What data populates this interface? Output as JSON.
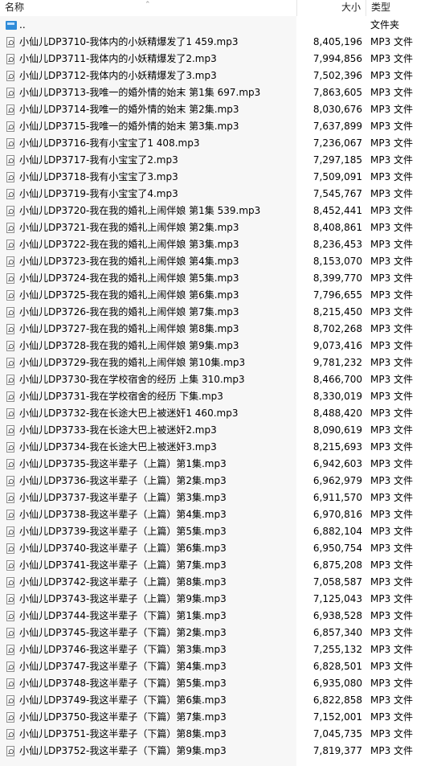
{
  "columns": {
    "name": "名称",
    "size": "大小",
    "type": "类型"
  },
  "parent_row": {
    "name": "..",
    "type": "文件夹",
    "icon": "folder-up-icon"
  },
  "file_icon": "audio-file-icon",
  "files": [
    {
      "name": "小仙儿DP3710-我体内的小妖精爆发了1 459.mp3",
      "size": "8,405,196",
      "type": "MP3 文件"
    },
    {
      "name": "小仙儿DP3711-我体内的小妖精爆发了2.mp3",
      "size": "7,994,856",
      "type": "MP3 文件"
    },
    {
      "name": "小仙儿DP3712-我体内的小妖精爆发了3.mp3",
      "size": "7,502,396",
      "type": "MP3 文件"
    },
    {
      "name": "小仙儿DP3713-我唯一的婚外情的始末 第1集 697.mp3",
      "size": "7,863,605",
      "type": "MP3 文件"
    },
    {
      "name": "小仙儿DP3714-我唯一的婚外情的始末 第2集.mp3",
      "size": "8,030,676",
      "type": "MP3 文件"
    },
    {
      "name": "小仙儿DP3715-我唯一的婚外情的始末 第3集.mp3",
      "size": "7,637,899",
      "type": "MP3 文件"
    },
    {
      "name": "小仙儿DP3716-我有小宝宝了1 408.mp3",
      "size": "7,236,067",
      "type": "MP3 文件"
    },
    {
      "name": "小仙儿DP3717-我有小宝宝了2.mp3",
      "size": "7,297,185",
      "type": "MP3 文件"
    },
    {
      "name": "小仙儿DP3718-我有小宝宝了3.mp3",
      "size": "7,509,091",
      "type": "MP3 文件"
    },
    {
      "name": "小仙儿DP3719-我有小宝宝了4.mp3",
      "size": "7,545,767",
      "type": "MP3 文件"
    },
    {
      "name": "小仙儿DP3720-我在我的婚礼上闹伴娘 第1集 539.mp3",
      "size": "8,452,441",
      "type": "MP3 文件"
    },
    {
      "name": "小仙儿DP3721-我在我的婚礼上闹伴娘 第2集.mp3",
      "size": "8,408,861",
      "type": "MP3 文件"
    },
    {
      "name": "小仙儿DP3722-我在我的婚礼上闹伴娘 第3集.mp3",
      "size": "8,236,453",
      "type": "MP3 文件"
    },
    {
      "name": "小仙儿DP3723-我在我的婚礼上闹伴娘 第4集.mp3",
      "size": "8,153,070",
      "type": "MP3 文件"
    },
    {
      "name": "小仙儿DP3724-我在我的婚礼上闹伴娘 第5集.mp3",
      "size": "8,399,770",
      "type": "MP3 文件"
    },
    {
      "name": "小仙儿DP3725-我在我的婚礼上闹伴娘 第6集.mp3",
      "size": "7,796,655",
      "type": "MP3 文件"
    },
    {
      "name": "小仙儿DP3726-我在我的婚礼上闹伴娘 第7集.mp3",
      "size": "8,215,450",
      "type": "MP3 文件"
    },
    {
      "name": "小仙儿DP3727-我在我的婚礼上闹伴娘 第8集.mp3",
      "size": "8,702,268",
      "type": "MP3 文件"
    },
    {
      "name": "小仙儿DP3728-我在我的婚礼上闹伴娘 第9集.mp3",
      "size": "9,073,416",
      "type": "MP3 文件"
    },
    {
      "name": "小仙儿DP3729-我在我的婚礼上闹伴娘 第10集.mp3",
      "size": "9,781,232",
      "type": "MP3 文件"
    },
    {
      "name": "小仙儿DP3730-我在学校宿舍的经历 上集 310.mp3",
      "size": "8,466,700",
      "type": "MP3 文件"
    },
    {
      "name": "小仙儿DP3731-我在学校宿舍的经历 下集.mp3",
      "size": "8,330,019",
      "type": "MP3 文件"
    },
    {
      "name": "小仙儿DP3732-我在长途大巴上被迷奸1 460.mp3",
      "size": "8,488,420",
      "type": "MP3 文件"
    },
    {
      "name": "小仙儿DP3733-我在长途大巴上被迷奸2.mp3",
      "size": "8,090,619",
      "type": "MP3 文件"
    },
    {
      "name": "小仙儿DP3734-我在长途大巴上被迷奸3.mp3",
      "size": "8,215,693",
      "type": "MP3 文件"
    },
    {
      "name": "小仙儿DP3735-我这半辈子（上篇）第1集.mp3",
      "size": "6,942,603",
      "type": "MP3 文件"
    },
    {
      "name": "小仙儿DP3736-我这半辈子（上篇）第2集.mp3",
      "size": "6,962,979",
      "type": "MP3 文件"
    },
    {
      "name": "小仙儿DP3737-我这半辈子（上篇）第3集.mp3",
      "size": "6,911,570",
      "type": "MP3 文件"
    },
    {
      "name": "小仙儿DP3738-我这半辈子（上篇）第4集.mp3",
      "size": "6,970,816",
      "type": "MP3 文件"
    },
    {
      "name": "小仙儿DP3739-我这半辈子（上篇）第5集.mp3",
      "size": "6,882,104",
      "type": "MP3 文件"
    },
    {
      "name": "小仙儿DP3740-我这半辈子（上篇）第6集.mp3",
      "size": "6,950,754",
      "type": "MP3 文件"
    },
    {
      "name": "小仙儿DP3741-我这半辈子（上篇）第7集.mp3",
      "size": "6,875,208",
      "type": "MP3 文件"
    },
    {
      "name": "小仙儿DP3742-我这半辈子（上篇）第8集.mp3",
      "size": "7,058,587",
      "type": "MP3 文件"
    },
    {
      "name": "小仙儿DP3743-我这半辈子（上篇）第9集.mp3",
      "size": "7,125,043",
      "type": "MP3 文件"
    },
    {
      "name": "小仙儿DP3744-我这半辈子（下篇）第1集.mp3",
      "size": "6,938,528",
      "type": "MP3 文件"
    },
    {
      "name": "小仙儿DP3745-我这半辈子（下篇）第2集.mp3",
      "size": "6,857,340",
      "type": "MP3 文件"
    },
    {
      "name": "小仙儿DP3746-我这半辈子（下篇）第3集.mp3",
      "size": "7,255,132",
      "type": "MP3 文件"
    },
    {
      "name": "小仙儿DP3747-我这半辈子（下篇）第4集.mp3",
      "size": "6,828,501",
      "type": "MP3 文件"
    },
    {
      "name": "小仙儿DP3748-我这半辈子（下篇）第5集.mp3",
      "size": "6,935,080",
      "type": "MP3 文件"
    },
    {
      "name": "小仙儿DP3749-我这半辈子（下篇）第6集.mp3",
      "size": "6,822,858",
      "type": "MP3 文件"
    },
    {
      "name": "小仙儿DP3750-我这半辈子（下篇）第7集.mp3",
      "size": "7,152,001",
      "type": "MP3 文件"
    },
    {
      "name": "小仙儿DP3751-我这半辈子（下篇）第8集.mp3",
      "size": "7,045,735",
      "type": "MP3 文件"
    },
    {
      "name": "小仙儿DP3752-我这半辈子（下篇）第9集.mp3",
      "size": "7,819,377",
      "type": "MP3 文件"
    }
  ]
}
